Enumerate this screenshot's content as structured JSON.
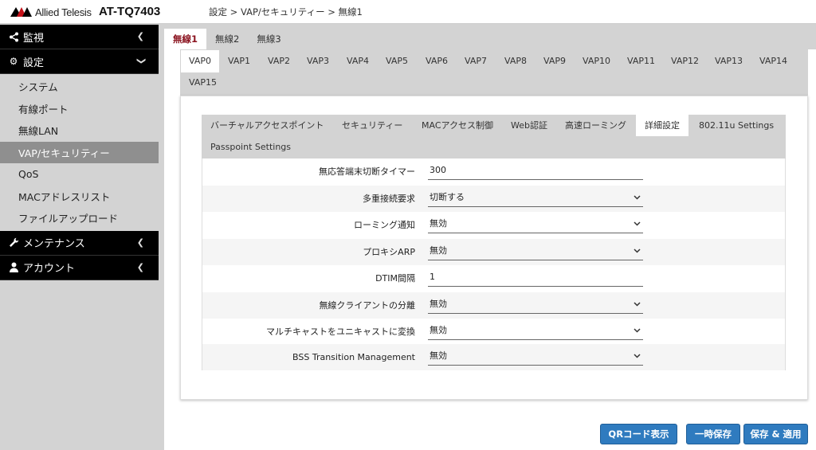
{
  "header": {
    "logo_text": "Allied Telesis",
    "model": "AT-TQ7403",
    "breadcrumb": "設定 > VAP/セキュリティー > 無線1"
  },
  "sidebar": {
    "monitor": "監視",
    "settings": "設定",
    "items": [
      "システム",
      "有線ポート",
      "無線LAN",
      "VAP/セキュリティー",
      "QoS",
      "MACアドレスリスト",
      "ファイルアップロード"
    ],
    "maintenance": "メンテナンス",
    "account": "アカウント"
  },
  "wireless_tabs": [
    "無線1",
    "無線2",
    "無線3"
  ],
  "vap_tabs": [
    "VAP0",
    "VAP1",
    "VAP2",
    "VAP3",
    "VAP4",
    "VAP5",
    "VAP6",
    "VAP7",
    "VAP8",
    "VAP9",
    "VAP10",
    "VAP11",
    "VAP12",
    "VAP13",
    "VAP14",
    "VAP15"
  ],
  "sub_tabs": [
    "バーチャルアクセスポイント",
    "セキュリティー",
    "MACアクセス制御",
    "Web認証",
    "高速ローミング",
    "詳細設定",
    "802.11u Settings",
    "Passpoint Settings"
  ],
  "form": [
    {
      "label": "無応答端末切断タイマー",
      "value": "300",
      "type": "text"
    },
    {
      "label": "多重接続要求",
      "value": "切断する",
      "type": "select"
    },
    {
      "label": "ローミング通知",
      "value": "無効",
      "type": "select"
    },
    {
      "label": "プロキシARP",
      "value": "無効",
      "type": "select"
    },
    {
      "label": "DTIM間隔",
      "value": "1",
      "type": "text"
    },
    {
      "label": "無線クライアントの分離",
      "value": "無効",
      "type": "select"
    },
    {
      "label": "マルチキャストをユニキャストに変換",
      "value": "無効",
      "type": "select"
    },
    {
      "label": "BSS Transition Management",
      "value": "無効",
      "type": "select"
    }
  ],
  "buttons": {
    "qr": "QRコード表示",
    "temp_save": "一時保存",
    "save_apply": "保存 & 適用"
  },
  "colors": {
    "accent": "#2f7bbf",
    "active_tab_text": "#8b1420",
    "sidebar_active": "#8f8f8f"
  }
}
